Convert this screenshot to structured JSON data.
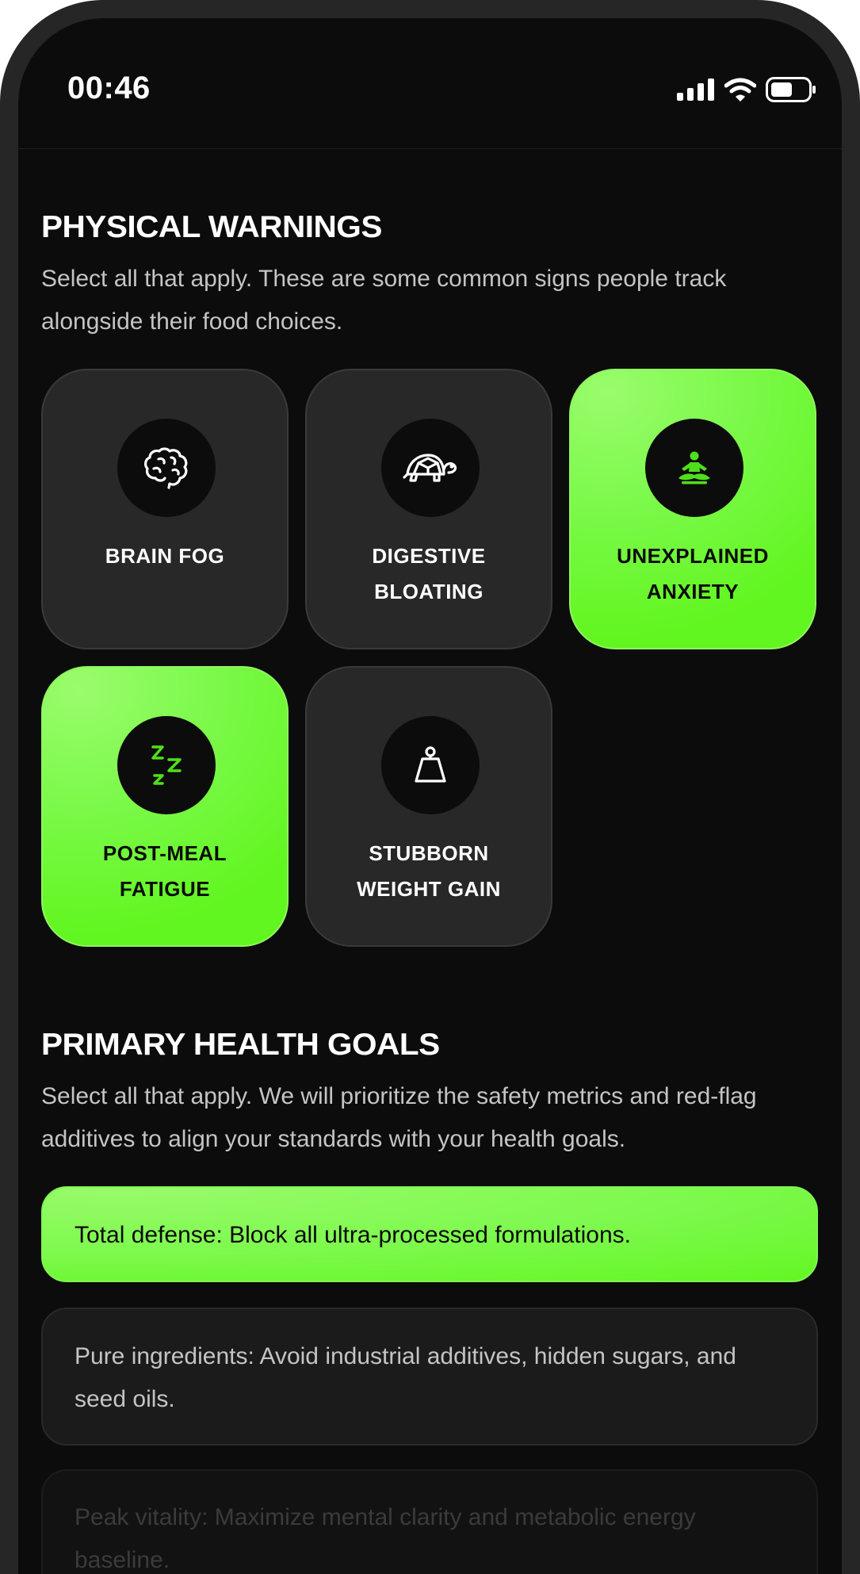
{
  "status_bar": {
    "time": "00:46",
    "icons": [
      "signal-icon",
      "wifi-icon",
      "battery-icon"
    ]
  },
  "physical_warnings": {
    "title": "PHYSICAL WARNINGS",
    "description": "Select all that apply. These are some common signs people track alongside their food choices.",
    "cards": [
      {
        "icon": "brain-icon",
        "line1": "BRAIN FOG",
        "line2": "",
        "selected": false
      },
      {
        "icon": "turtle-icon",
        "line1": "DIGESTIVE",
        "line2": "BLOATING",
        "selected": false
      },
      {
        "icon": "meditation-icon",
        "line1": "UNEXPLAINED",
        "line2": "ANXIETY",
        "selected": true
      },
      {
        "icon": "sleep-zzz-icon",
        "line1": "POST-MEAL",
        "line2": "FATIGUE",
        "selected": true
      },
      {
        "icon": "weight-icon",
        "line1": "STUBBORN",
        "line2": "WEIGHT GAIN",
        "selected": false
      }
    ]
  },
  "primary_health_goals": {
    "title": "PRIMARY HEALTH GOALS",
    "description": "Select all that apply. We will prioritize the safety metrics and red-flag additives to align your standards with your health goals.",
    "options": [
      {
        "text": "Total defense: Block all ultra-processed formulations.",
        "selected": true
      },
      {
        "text": "Pure ingredients: Avoid industrial additives, hidden sugars, and seed oils.",
        "selected": false
      },
      {
        "text": "Peak vitality: Maximize mental clarity and metabolic energy baseline.",
        "selected": false
      }
    ]
  },
  "colors": {
    "accent": "#7cf94b",
    "background": "#0c0c0c",
    "card": "#282828",
    "icon_accent": "#4fe01a"
  }
}
